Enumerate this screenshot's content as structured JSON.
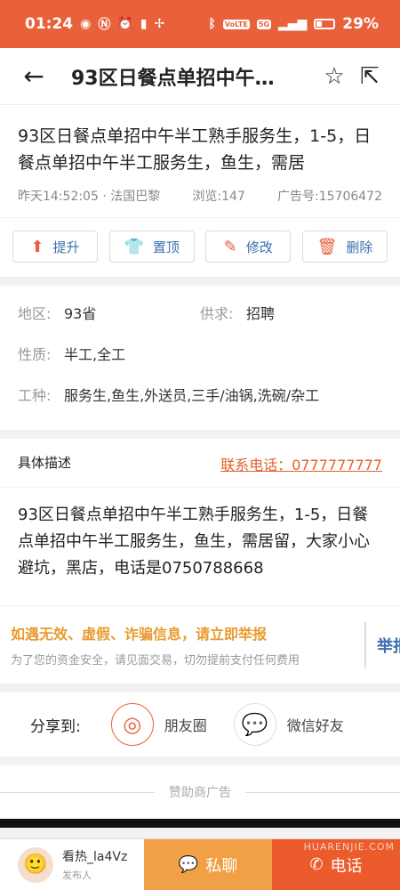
{
  "status_bar": {
    "time": "01:24",
    "volte": "VoLTE",
    "network": "5G",
    "battery": "29%"
  },
  "nav": {
    "title": "93区日餐点单招中午…"
  },
  "post": {
    "title": "93区日餐点单招中午半工熟手服务生，1-5，日餐点单招中午半工服务生，鱼生，需居",
    "posted": "昨天14:52:05 · 法国巴黎",
    "views": "浏览:147",
    "ad_number": "广告号:15706472"
  },
  "actions": [
    {
      "label": "提升",
      "icon": "arrow-up-icon"
    },
    {
      "label": "置顶",
      "icon": "shirt-icon"
    },
    {
      "label": "修改",
      "icon": "pencil-icon"
    },
    {
      "label": "删除",
      "icon": "trash-icon"
    }
  ],
  "info": {
    "region_label": "地区:",
    "region_value": "93省",
    "supply_label": "供求:",
    "supply_value": "招聘",
    "nature_label": "性质:",
    "nature_value": "半工,全工",
    "jobtype_label": "工种:",
    "jobtype_value": "服务生,鱼生,外送员,三手/油锅,洗碗/杂工"
  },
  "description": {
    "header": "具体描述",
    "phone": "联系电话：0777777777",
    "body": "93区日餐点单招中午半工熟手服务生，1-5，日餐点单招中午半工服务生，鱼生，需居留，大家小心避坑，黑店，电话是0750788668"
  },
  "warning": {
    "title": "如遇无效、虚假、诈骗信息，请立即举报",
    "subtitle": "为了您的资金安全，请见面交易，切勿提前支付任何费用",
    "report": "举报"
  },
  "share": {
    "label": "分享到:",
    "moments": "朋友圈",
    "wechat": "微信好友"
  },
  "sponsor": "赞助商广告",
  "bottom": {
    "publisher_name": "看热_la4Vz",
    "publisher_role": "发布人",
    "chat": "私聊",
    "call": "电话",
    "watermark": "HUARENJIE.COM"
  }
}
